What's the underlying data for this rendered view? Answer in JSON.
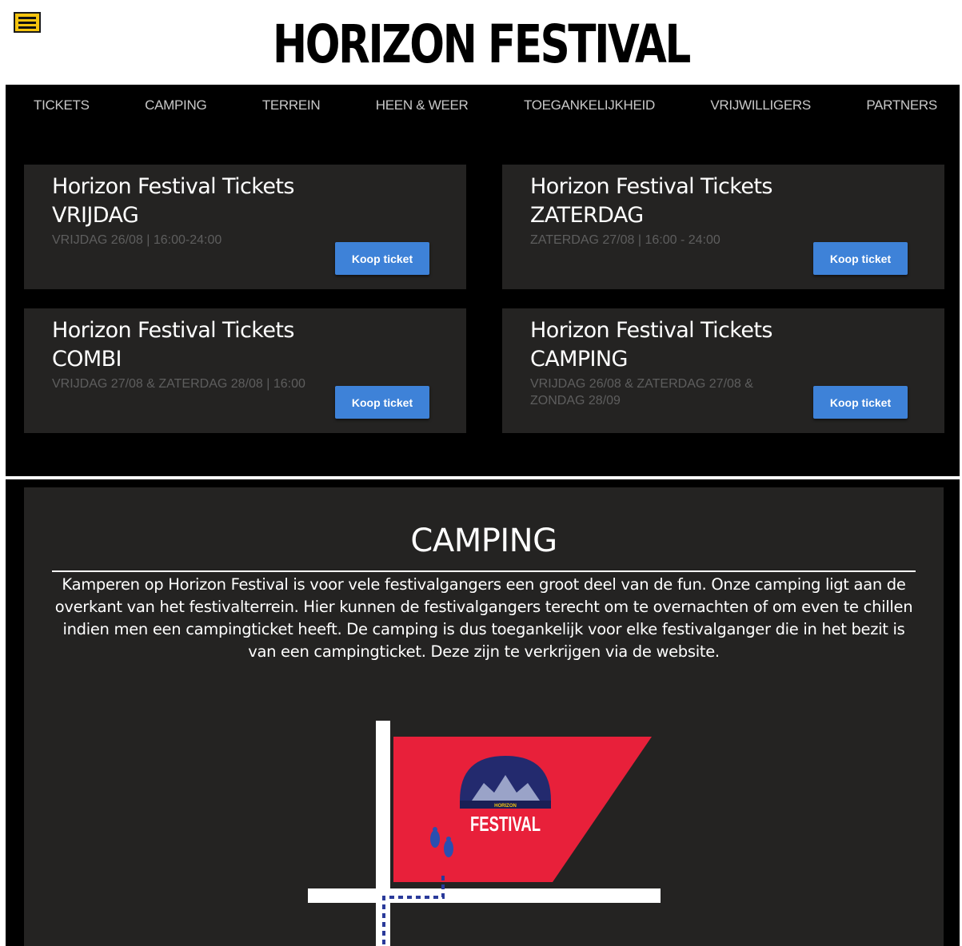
{
  "header": {
    "logo_text": "HORIZON FESTIVAL",
    "menu_icon": "hamburger-icon"
  },
  "nav": {
    "items": [
      {
        "label": "TICKETS"
      },
      {
        "label": "CAMPING"
      },
      {
        "label": "TERREIN"
      },
      {
        "label": "HEEN & WEER"
      },
      {
        "label": "TOEGANKELIJKHEID"
      },
      {
        "label": "VRIJWILLIGERS"
      },
      {
        "label": "PARTNERS"
      }
    ]
  },
  "tickets": [
    {
      "title_line1": "Horizon Festival Tickets",
      "title_line2": "VRIJDAG",
      "date": "VRIJDAG 26/08 | 16:00-24:00",
      "button": "Koop ticket"
    },
    {
      "title_line1": "Horizon Festival Tickets",
      "title_line2": "ZATERDAG",
      "date": "ZATERDAG 27/08 | 16:00 - 24:00",
      "button": "Koop ticket"
    },
    {
      "title_line1": "Horizon Festival Tickets",
      "title_line2": "COMBI",
      "date": "VRIJDAG 27/08 & ZATERDAG 28/08 | 16:00",
      "button": "Koop ticket"
    },
    {
      "title_line1": "Horizon Festival Tickets",
      "title_line2": "CAMPING",
      "date": "VRIJDAG 26/08 & ZATERDAG 27/08 & ZONDAG 28/09",
      "button": "Koop ticket"
    }
  ],
  "camping": {
    "title": "CAMPING",
    "text": "Kamperen op Horizon Festival is voor vele festivalgangers een groot deel van de fun. Onze camping ligt aan de overkant van het festivalterrein. Hier kunnen de festivalgangers terecht om te overnachten of om even te chillen indien men een campingticket heeft. De camping is dus toegankelijk voor elke festivalganger die in het bezit is van een campingticket. Deze zijn te verkrijgen via de website.",
    "map_logo_small": "HORIZON",
    "map_logo_big": "FESTIVAL"
  },
  "colors": {
    "accent_yellow": "#f5c40f",
    "button_blue": "#3e82d8",
    "map_red": "#e8203a",
    "map_navy": "#232a6e"
  }
}
